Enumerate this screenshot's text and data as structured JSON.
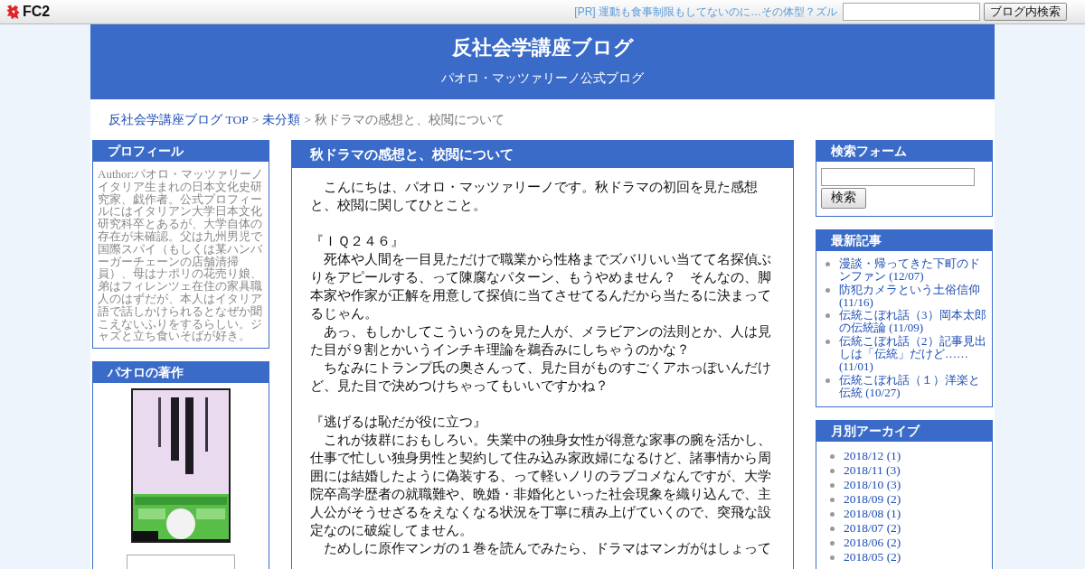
{
  "top_bar": {
    "logo": "FC2",
    "ad_link": "[PR] 運動も食事制限もしてないのに…その体型？ズル",
    "search_button": "ブログ内検索"
  },
  "header": {
    "title": "反社会学講座ブログ",
    "subtitle": "パオロ・マッツァリーノ公式ブログ"
  },
  "breadcrumb": [
    {
      "kind": "link",
      "label": "反社会学講座ブログ TOP"
    },
    {
      "kind": "separator",
      "label": ">"
    },
    {
      "kind": "link",
      "label": "未分類"
    },
    {
      "kind": "separator",
      "label": ">"
    },
    {
      "kind": "current",
      "label": "秋ドラマの感想と、校閲について"
    }
  ],
  "left_sidebar": [
    {
      "kind": "profile",
      "title": "プロフィール",
      "author": "Author:パオロ・マッツァリーノ",
      "bio": "イタリア生まれの日本文化史研究家、戯作者。公式プロフィールにはイタリアン大学日本文化研究科卒とあるが、大学自体の存在が未確認。父は九州男児で国際スパイ（もしくは某ハンバーガーチェーンの店舗清掃員）、母はナポリの花売り娘、弟はフィレンツェ在住の家具職人のはずだが、本人はイタリア語で話しかけられるとなぜか聞こえないふりをするらしい。ジャズと立ち食いそばが好き。"
    },
    {
      "kind": "covers",
      "title": "パオロの著作",
      "items": [
        {
          "kind": "cover"
        },
        {
          "kind": "cover"
        }
      ]
    }
  ],
  "article": {
    "title": "秋ドラマの感想と、校閲について",
    "intro": "　こんにちは、パオロ・マッツァリーノです。秋ドラマの初回を見た感想と、校閲に関してひとこと。",
    "sections": [
      {
        "heading": "『ＩＱ２４６』",
        "paragraphs": [
          "　死体や人間を一目見ただけで職業から性格までズバリいい当てて名探偵ぶりをアピールする、って陳腐なパターン、もうやめません？　そんなの、脚本家や作家が正解を用意して探偵に当てさせてるんだから当たるに決まってるじゃん。",
          "　あっ、もしかしてこういうのを見た人が、メラビアンの法則とか、人は見た目が９割とかいうインチキ理論を鵜呑みにしちゃうのかな？",
          "　ちなみにトランプ氏の奥さんって、見た目がものすごくアホっぽいんだけど、見た目で決めつけちゃってもいいですかね？"
        ]
      },
      {
        "heading": "『逃げるは恥だが役に立つ』",
        "paragraphs": [
          "　これが抜群におもしろい。失業中の独身女性が得意な家事の腕を活かし、仕事で忙しい独身男性と契約して住み込み家政婦になるけど、諸事情から周囲には結婚したように偽装する、って軽いノリのラブコメなんですが、大学院卒高学歴者の就職難や、晩婚・非婚化といった社会現象を織り込んで、主人公がそうせざるをえなくなる状況を丁寧に積み上げていくので、突飛な設定なのに破綻してません。",
          "　ためしに原作マンガの１巻を読んでみたら、ドラマはマンガがはしょって"
        ]
      }
    ]
  },
  "right_sidebar": [
    {
      "kind": "search",
      "title": "検索フォーム",
      "button": "検索"
    },
    {
      "kind": "recent",
      "title": "最新記事",
      "items": [
        "漫談・帰ってきた下町のドンファン (12/07)",
        "防犯カメラという土俗信仰 (11/16)",
        "伝統こぼれ話（3）岡本太郎の伝統論 (11/09)",
        "伝統こぼれ話（2）記事見出しは「伝統」だけど…… (11/01)",
        "伝統こぼれ話（１）洋楽と伝統 (10/27)"
      ]
    },
    {
      "kind": "archive",
      "title": "月別アーカイブ",
      "items": [
        "2018/12 (1)",
        "2018/11 (3)",
        "2018/10 (3)",
        "2018/09 (2)",
        "2018/08 (1)",
        "2018/07 (2)",
        "2018/06 (2)",
        "2018/05 (2)"
      ]
    }
  ]
}
